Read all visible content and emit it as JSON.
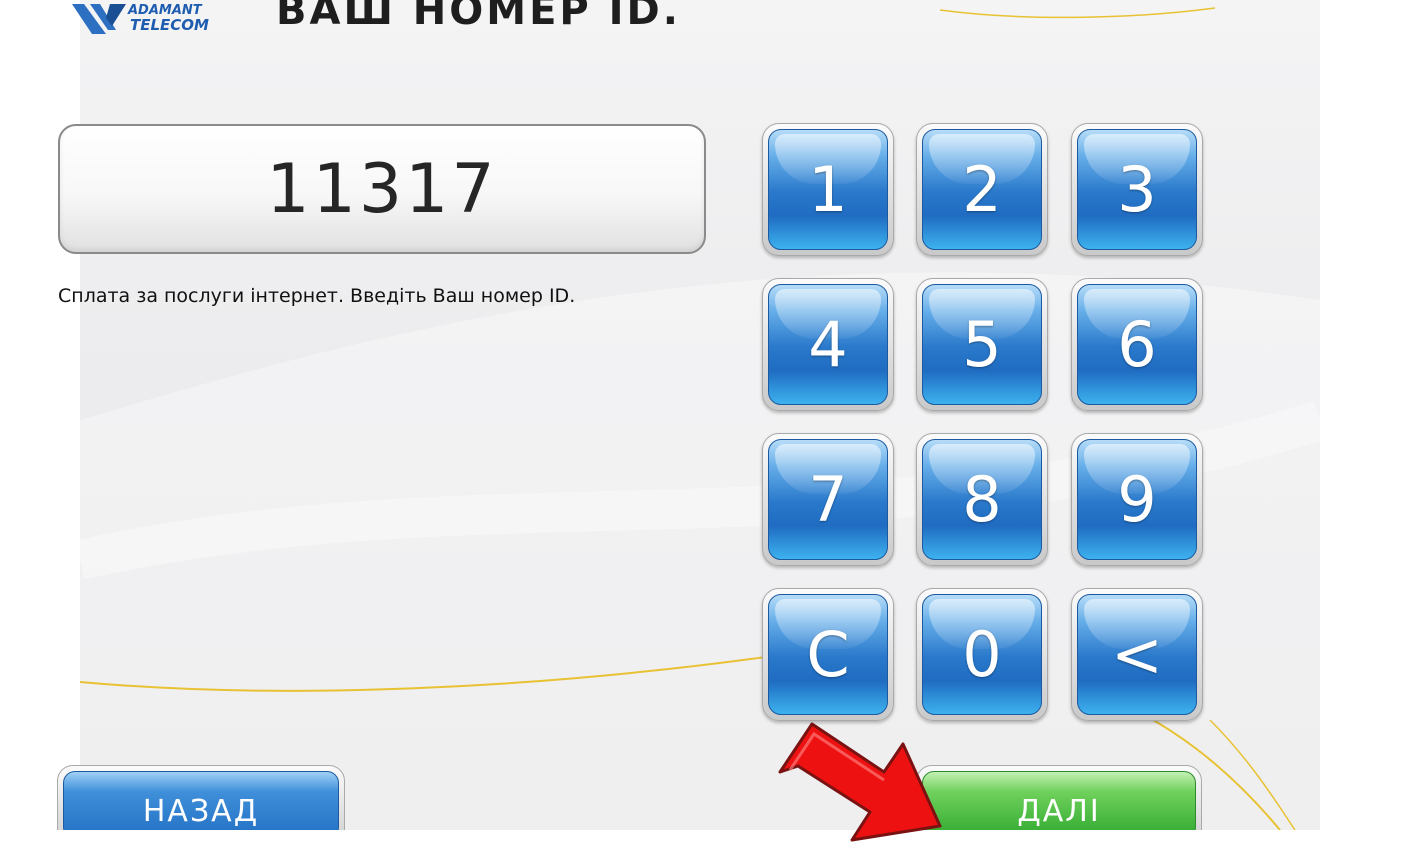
{
  "header": {
    "logo_text_top": "ADAMANT",
    "logo_text_bottom": "TELECOM",
    "title": "ВАШ НОМЕР ID."
  },
  "input": {
    "value": "11317"
  },
  "hint": "Сплата за послуги інтернет. Введіть Ваш номер ID.",
  "keypad": {
    "keys": [
      "1",
      "2",
      "3",
      "4",
      "5",
      "6",
      "7",
      "8",
      "9",
      "C",
      "0",
      "<"
    ]
  },
  "buttons": {
    "back": "НАЗАД",
    "next": "ДАЛІ"
  },
  "colors": {
    "key_blue": "#2a79cb",
    "next_green": "#2fa82f",
    "annotation_arrow": "#ee1111",
    "accent_line": "#e8c233"
  },
  "annotation": {
    "icon": "red-arrow-icon",
    "points_to": "next-button"
  }
}
